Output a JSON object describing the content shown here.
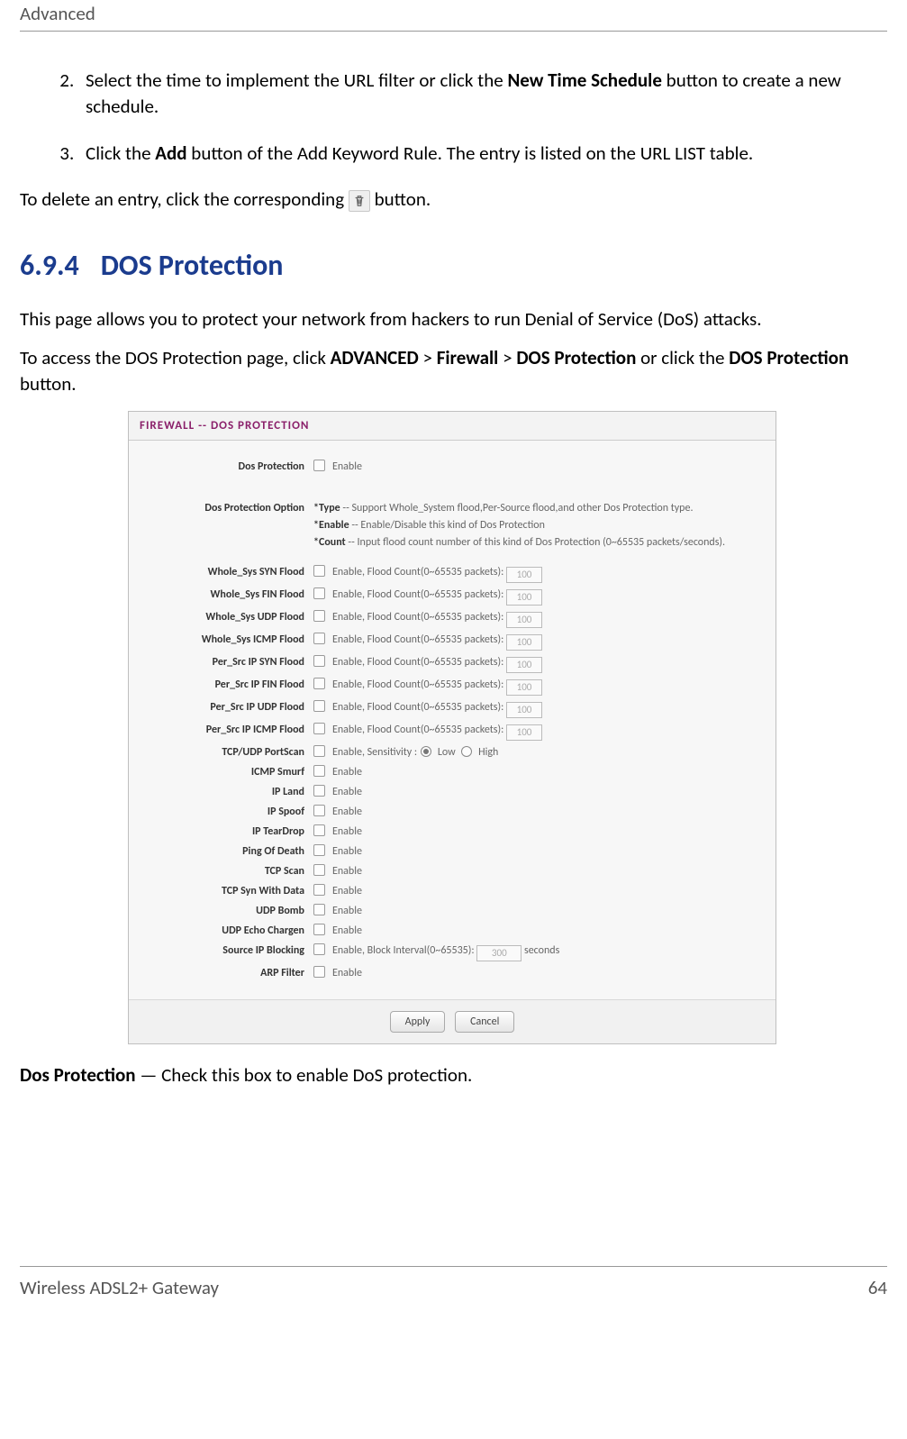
{
  "header": {
    "chapter": "Advanced"
  },
  "steps": [
    {
      "n": "2.",
      "pre": "Select the time to implement the URL filter or click the ",
      "boldA": "New Time Schedule",
      "post": " button to create a new schedule."
    },
    {
      "n": "3.",
      "pre": "Click the ",
      "boldA": "Add",
      "post": " button of the Add Keyword Rule. The entry is listed on the URL LIST table."
    }
  ],
  "delete_line": {
    "pre": "To delete an entry, click the corresponding ",
    "post": " button."
  },
  "section": {
    "num": "6.9.4",
    "title": "DOS Protection"
  },
  "intro": "This page allows you to protect your network from hackers to run Denial of Service (DoS) attacks.",
  "access": {
    "pre": "To access the DOS Protection page, click ",
    "b1": "ADVANCED",
    "s1": " > ",
    "b2": "Firewall",
    "s2": " > ",
    "b3": "DOS Protection",
    "mid": " or click the ",
    "b4": "DOS Protection",
    "post": " button."
  },
  "chart_data": {
    "type": "table",
    "title": "FIREWALL -- DOS PROTECTION",
    "rows": [
      {
        "label": "Dos Protection",
        "control": "checkbox",
        "text_after": "Enable"
      },
      {
        "label": "Dos Protection Option",
        "control": "info",
        "lines": [
          {
            "b": "*Type",
            "t": " -- Support Whole_System flood,Per-Source flood,and other Dos Protection type."
          },
          {
            "b": "*Enable",
            "t": " -- Enable/Disable this kind of Dos Protection"
          },
          {
            "b": "*Count",
            "t": " -- Input flood count number of this kind of Dos Protection (0~65535 packets/seconds)."
          }
        ]
      },
      {
        "label": "Whole_Sys SYN Flood",
        "control": "cb_count",
        "text": "Enable, Flood Count(0~65535 packets):",
        "value": "100"
      },
      {
        "label": "Whole_Sys FIN Flood",
        "control": "cb_count",
        "text": "Enable, Flood Count(0~65535 packets):",
        "value": "100"
      },
      {
        "label": "Whole_Sys UDP Flood",
        "control": "cb_count",
        "text": "Enable, Flood Count(0~65535 packets):",
        "value": "100"
      },
      {
        "label": "Whole_Sys ICMP Flood",
        "control": "cb_count",
        "text": "Enable, Flood Count(0~65535 packets):",
        "value": "100"
      },
      {
        "label": "Per_Src IP SYN Flood",
        "control": "cb_count",
        "text": "Enable, Flood Count(0~65535 packets):",
        "value": "100"
      },
      {
        "label": "Per_Src IP FIN Flood",
        "control": "cb_count",
        "text": "Enable, Flood Count(0~65535 packets):",
        "value": "100"
      },
      {
        "label": "Per_Src IP UDP Flood",
        "control": "cb_count",
        "text": "Enable, Flood Count(0~65535 packets):",
        "value": "100"
      },
      {
        "label": "Per_Src IP ICMP Flood",
        "control": "cb_count",
        "text": "Enable, Flood Count(0~65535 packets):",
        "value": "100"
      },
      {
        "label": "TCP/UDP PortScan",
        "control": "cb_radio",
        "text": "Enable, Sensitivity :",
        "radios": [
          "Low",
          "High"
        ],
        "selected": 0
      },
      {
        "label": "ICMP Smurf",
        "control": "checkbox",
        "text_after": "Enable"
      },
      {
        "label": "IP Land",
        "control": "checkbox",
        "text_after": "Enable"
      },
      {
        "label": "IP Spoof",
        "control": "checkbox",
        "text_after": "Enable"
      },
      {
        "label": "IP TearDrop",
        "control": "checkbox",
        "text_after": "Enable"
      },
      {
        "label": "Ping Of Death",
        "control": "checkbox",
        "text_after": "Enable"
      },
      {
        "label": "TCP Scan",
        "control": "checkbox",
        "text_after": "Enable"
      },
      {
        "label": "TCP Syn With Data",
        "control": "checkbox",
        "text_after": "Enable"
      },
      {
        "label": "UDP Bomb",
        "control": "checkbox",
        "text_after": "Enable"
      },
      {
        "label": "UDP Echo Chargen",
        "control": "checkbox",
        "text_after": "Enable"
      },
      {
        "label": "Source IP Blocking",
        "control": "cb_interval",
        "text": "Enable, Block Interval(0~65535):",
        "value": "300",
        "unit": "seconds"
      },
      {
        "label": "ARP Filter",
        "control": "checkbox",
        "text_after": "Enable"
      }
    ],
    "buttons": [
      "Apply",
      "Cancel"
    ]
  },
  "outro": {
    "b": "Dos Protection",
    "t": " — Check this box to enable DoS protection."
  },
  "footer": {
    "left": "Wireless ADSL2+ Gateway",
    "right": "64"
  }
}
